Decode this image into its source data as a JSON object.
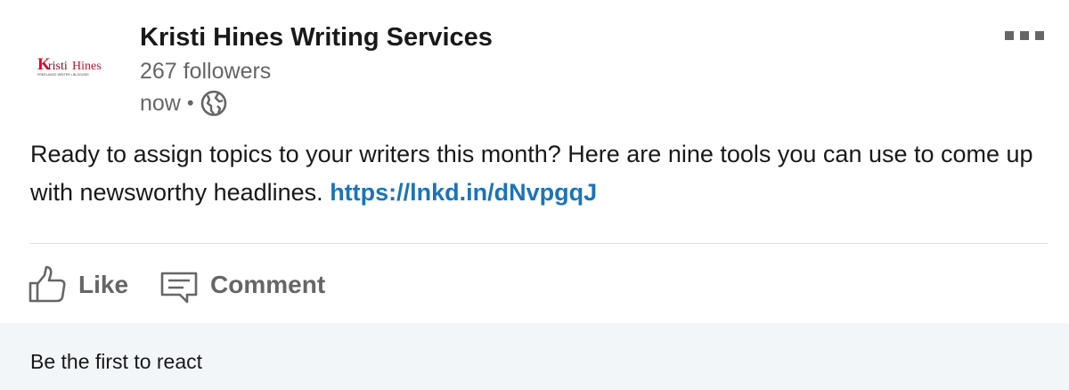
{
  "post": {
    "author": {
      "name": "Kristi Hines Writing Services",
      "followers": "267 followers",
      "timestamp": "now",
      "visibility_icon": "globe-icon",
      "logo": {
        "brand_text": "KristiHines",
        "tagline": "FREELANCE WRITER • BLOGGER"
      }
    },
    "more_icon": "more-options-icon",
    "text": "Ready to assign topics to your writers this month? Here are nine tools you can use to come up with newsworthy headlines.",
    "link": "https://lnkd.in/dNvpgqJ",
    "actions": {
      "like_label": "Like",
      "like_icon": "thumbs-up-icon",
      "comment_label": "Comment",
      "comment_icon": "comment-icon"
    },
    "reactions_text": "Be the first to react"
  },
  "colors": {
    "link": "#1b74b9",
    "muted": "#666666",
    "reactions_bg": "#f3f6f8",
    "logo_red": "#c8102e"
  }
}
